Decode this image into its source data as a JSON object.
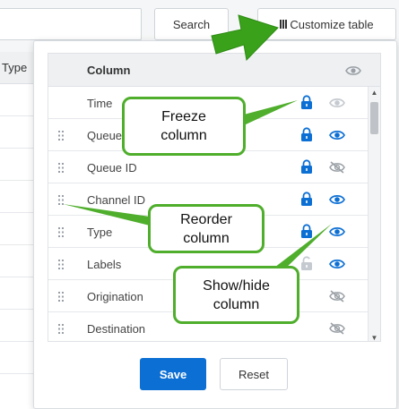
{
  "toolbar": {
    "search_label": "Search",
    "customize_label": "Customize table"
  },
  "background_table": {
    "visible_header": "Type"
  },
  "column_panel": {
    "header_label": "Column",
    "rows": [
      {
        "label": "Time",
        "frozen": true,
        "lock_state": "locked",
        "visible": true,
        "eye_state": "disabled",
        "draggable": false
      },
      {
        "label": "Queue",
        "frozen": true,
        "lock_state": "locked",
        "visible": true,
        "eye_state": "shown",
        "draggable": true
      },
      {
        "label": "Queue ID",
        "frozen": true,
        "lock_state": "locked",
        "visible": false,
        "eye_state": "hidden",
        "draggable": true
      },
      {
        "label": "Channel ID",
        "frozen": true,
        "lock_state": "locked",
        "visible": true,
        "eye_state": "shown",
        "draggable": true
      },
      {
        "label": "Type",
        "frozen": true,
        "lock_state": "locked",
        "visible": true,
        "eye_state": "shown",
        "draggable": true
      },
      {
        "label": "Labels",
        "frozen": false,
        "lock_state": "unlocked",
        "visible": true,
        "eye_state": "shown",
        "draggable": true
      },
      {
        "label": "Origination",
        "frozen": false,
        "lock_state": "none",
        "visible": false,
        "eye_state": "hidden",
        "draggable": true
      },
      {
        "label": "Destination",
        "frozen": false,
        "lock_state": "none",
        "visible": false,
        "eye_state": "hidden",
        "draggable": true
      }
    ],
    "save_label": "Save",
    "reset_label": "Reset"
  },
  "annotations": {
    "freeze": [
      "Freeze",
      "column"
    ],
    "reorder": [
      "Reorder",
      "column"
    ],
    "showhide": [
      "Show/hide",
      "column"
    ]
  },
  "colors": {
    "accent": "#0c6fd4",
    "callout_green": "#4fae2c",
    "arrow_green": "#39a21a",
    "icon_disabled": "#c5cad0",
    "icon_hidden": "#9aa0a6"
  }
}
